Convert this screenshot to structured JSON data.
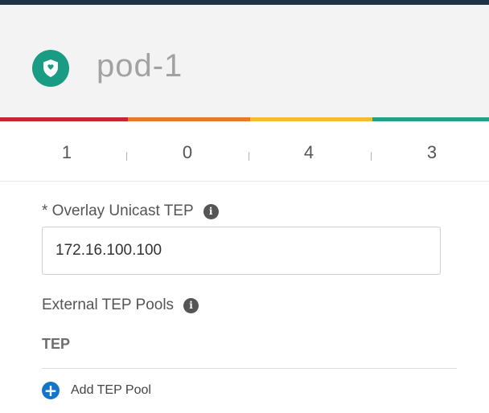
{
  "header": {
    "title": "pod-1",
    "icon": "shield-icon",
    "icon_color": "#1a9b84"
  },
  "health_bar": [
    {
      "color": "#c8262f"
    },
    {
      "color": "#e8792c"
    },
    {
      "color": "#f2be2e"
    },
    {
      "color": "#23a089"
    }
  ],
  "stats": [
    {
      "value": "1"
    },
    {
      "value": "0"
    },
    {
      "value": "4"
    },
    {
      "value": "3"
    }
  ],
  "overlay_unicast_tep": {
    "label": "* Overlay Unicast TEP",
    "info_icon": "info-icon",
    "value": "172.16.100.100"
  },
  "external_tep_pools": {
    "label": "External TEP Pools",
    "info_icon": "info-icon",
    "column_header": "TEP",
    "add_button_label": "Add TEP Pool",
    "add_icon": "plus-circle-icon",
    "add_icon_color": "#1576c9"
  }
}
